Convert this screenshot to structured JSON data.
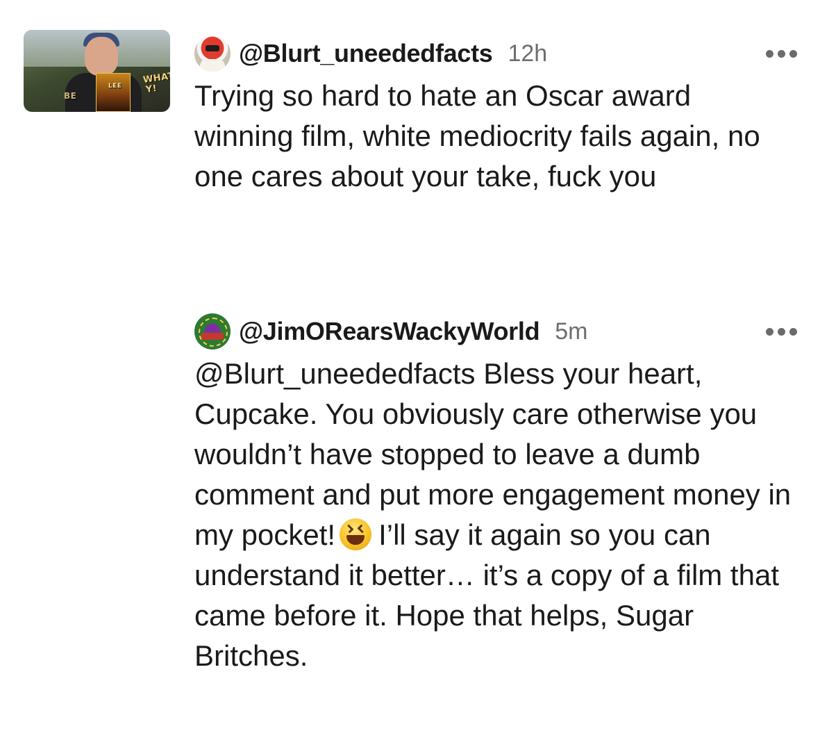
{
  "thumbnail": {
    "overlay_words": [
      "WHAT",
      "Y!",
      "LEE",
      "BE"
    ]
  },
  "comments": [
    {
      "username": "@Blurt_uneededfacts",
      "timestamp": "12h",
      "avatar_icon": "power-ranger-avatar",
      "text": "Trying so hard to hate an Oscar award winning film, white mediocrity fails again, no one cares about your take, fuck you"
    },
    {
      "username": "@JimORearsWackyWorld",
      "timestamp": "5m",
      "avatar_icon": "wacky-world-logo-avatar",
      "text_before_emoji": "@Blurt_uneededfacts Bless your heart, Cupcake. You obviously care otherwise you wouldn’t have stopped to leave a dumb comment and put more engagement money in my pocket!",
      "emoji": "grinning-squinting-face-emoji",
      "text_after_emoji": "I’ll say it again so you can understand it better… it’s a copy of a film that came before it. Hope that helps, Sugar Britches."
    }
  ],
  "colors": {
    "text": "#1a1a1a",
    "timestamp": "#6e6e6e",
    "menu_dots": "#6b6b6b",
    "background": "#ffffff"
  }
}
